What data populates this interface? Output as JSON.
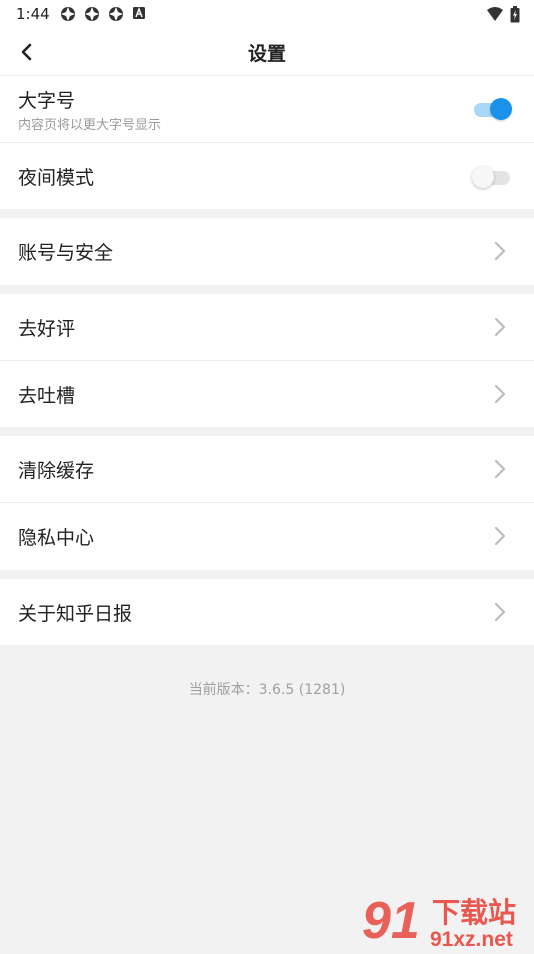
{
  "status_bar": {
    "time": "1:44",
    "left_icons": [
      "gear-like-icon",
      "gear-like-icon",
      "gear-like-icon",
      "a-badge-icon"
    ],
    "right_icons": [
      "wifi-icon",
      "battery-icon"
    ]
  },
  "app_bar": {
    "back_icon": "chevron-left-icon",
    "title": "设置"
  },
  "settings": {
    "large_font": {
      "label": "大字号",
      "subtitle": "内容页将以更大字号显示",
      "enabled": true
    },
    "night_mode": {
      "label": "夜间模式",
      "enabled": false
    },
    "account_security": {
      "label": "账号与安全"
    },
    "rate_app": {
      "label": "去好评"
    },
    "feedback": {
      "label": "去吐槽"
    },
    "clear_cache": {
      "label": "清除缓存"
    },
    "privacy_center": {
      "label": "隐私中心"
    },
    "about": {
      "label": "关于知乎日报"
    }
  },
  "version_text": "当前版本：3.6.5 (1281)",
  "watermark": {
    "logo_text": "91",
    "brand_text": "下载站",
    "url_text": "91xz.net"
  },
  "colors": {
    "accent": "#1c91ea",
    "background": "#f2f2f2",
    "watermark_red": "#e8463d"
  }
}
